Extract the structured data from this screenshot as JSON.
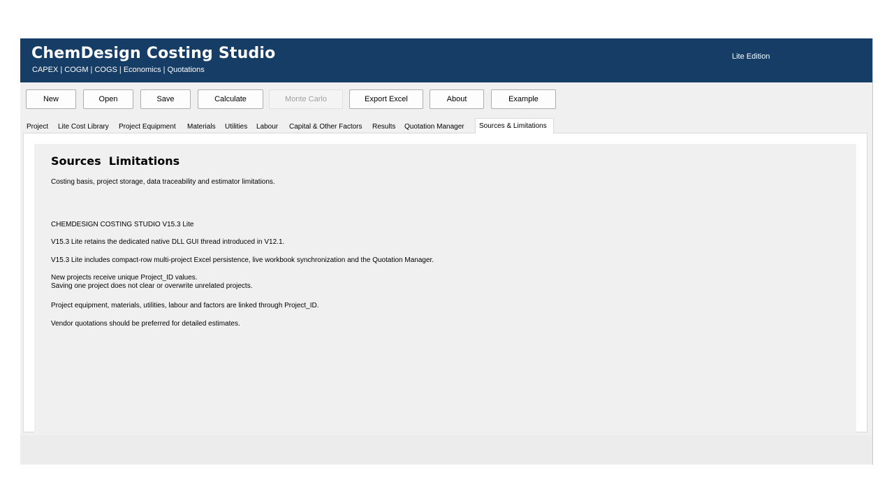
{
  "header": {
    "title": "ChemDesign Costing Studio",
    "subtitle": "CAPEX | COGM | COGS | Economics | Quotations",
    "edition": "Lite Edition"
  },
  "toolbar": {
    "new_label": "New",
    "open_label": "Open",
    "save_label": "Save",
    "calculate_label": "Calculate",
    "monte_carlo_label": "Monte Carlo",
    "export_excel_label": "Export Excel",
    "about_label": "About",
    "example_label": "Example"
  },
  "tabs": {
    "project": "Project",
    "lite_cost_library": "Lite Cost Library",
    "project_equipment": "Project Equipment",
    "materials": "Materials",
    "utilities": "Utilities",
    "labour": "Labour",
    "capital_factors": "Capital & Other Factors",
    "results": "Results",
    "quotation_manager": "Quotation Manager",
    "sources_limitations": "Sources & Limitations",
    "active": "Sources & Limitations"
  },
  "page": {
    "title": "Sources  Limitations",
    "subtitle": "Costing basis, project storage, data traceability and estimator limitations.",
    "lines": [
      "CHEMDESIGN COSTING STUDIO V15.3 Lite",
      "V15.3 Lite retains the dedicated native DLL GUI thread introduced in V12.1.",
      "V15.3 Lite includes compact-row multi-project Excel persistence, live workbook synchronization and the Quotation Manager.",
      "New projects receive unique Project_ID values.",
      "Saving one project does not clear or overwrite unrelated projects.",
      "Project equipment, materials, utilities, labour and factors are linked through Project_ID.",
      "Vendor quotations should be preferred for detailed estimates."
    ]
  },
  "colors": {
    "header_bg": "#163d66",
    "window_bg": "#f0f0f0",
    "tab_page_bg": "#ffffff",
    "disabled_text": "#a0a0a0"
  }
}
